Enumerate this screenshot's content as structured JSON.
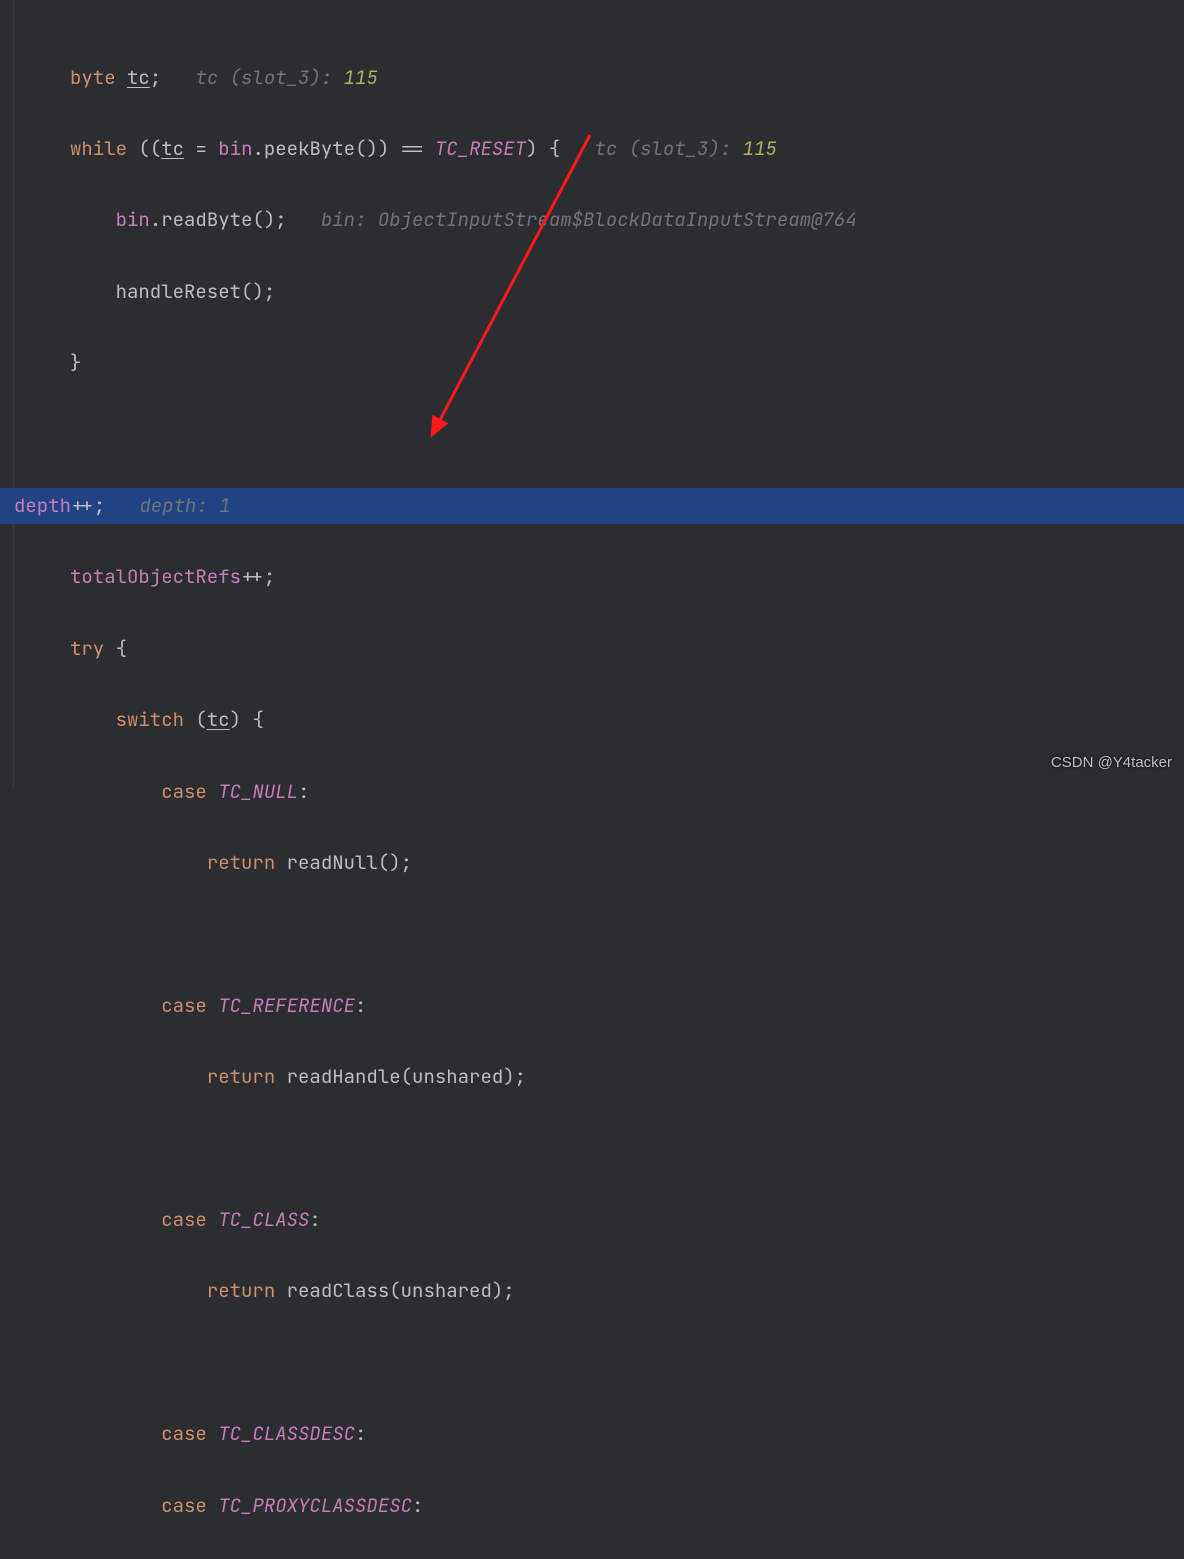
{
  "hints": {
    "tc_decl": "tc (slot_3): ",
    "tc_decl_val": "115",
    "tc_while": "tc (slot_3): ",
    "tc_while_val": "115",
    "bin_hint": "bin: ObjectInputStream$BlockDataInputStream@764",
    "depth_hint": "depth: 1"
  },
  "code": {
    "kw_byte": "byte",
    "tc": "tc",
    "kw_while": "while",
    "bin": "bin",
    "peekByte": "peekByte",
    "tc_reset": "TC_RESET",
    "readByte": "readByte",
    "handleReset": "handleReset",
    "depth": "depth",
    "plusplus": "++",
    "totalObjectRefs": "totalObjectRefs",
    "kw_try": "try",
    "kw_switch": "switch",
    "kw_case": "case",
    "kw_return": "return",
    "tc_null": "TC_NULL",
    "readNull": "readNull",
    "tc_reference": "TC_REFERENCE",
    "readHandle": "readHandle",
    "unshared": "unshared",
    "tc_class": "TC_CLASS",
    "readClass": "readClass",
    "tc_classdesc": "TC_CLASSDESC",
    "tc_proxyclassdesc": "TC_PROXYCLASSDESC"
  },
  "watermark": "CSDN @Y4tacker"
}
